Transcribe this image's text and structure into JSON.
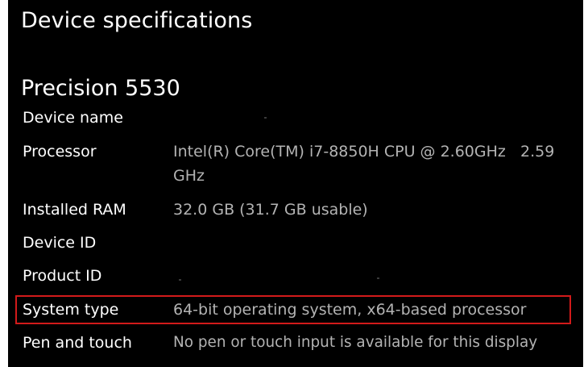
{
  "header": {
    "section_title": "Device specifications",
    "device_model": "Precision 5530"
  },
  "specs": [
    {
      "label": "Device name",
      "value": ""
    },
    {
      "label": "Processor",
      "value_line1": "Intel(R) Core(TM) i7-8850H CPU @ 2.60GHz   2.59",
      "value_line2": "GHz"
    },
    {
      "label": "Installed RAM",
      "value": "32.0 GB (31.7 GB usable)"
    },
    {
      "label": "Device ID",
      "value": ""
    },
    {
      "label": "Product ID",
      "value": ""
    },
    {
      "label": "System type",
      "value": "64-bit operating system, x64-based processor"
    },
    {
      "label": "Pen and touch",
      "value": "No pen or touch input is available for this display"
    }
  ],
  "colors": {
    "background": "#000000",
    "label_text": "#ffffff",
    "value_text": "#b3b3b3",
    "highlight_border": "#d21a1a"
  }
}
